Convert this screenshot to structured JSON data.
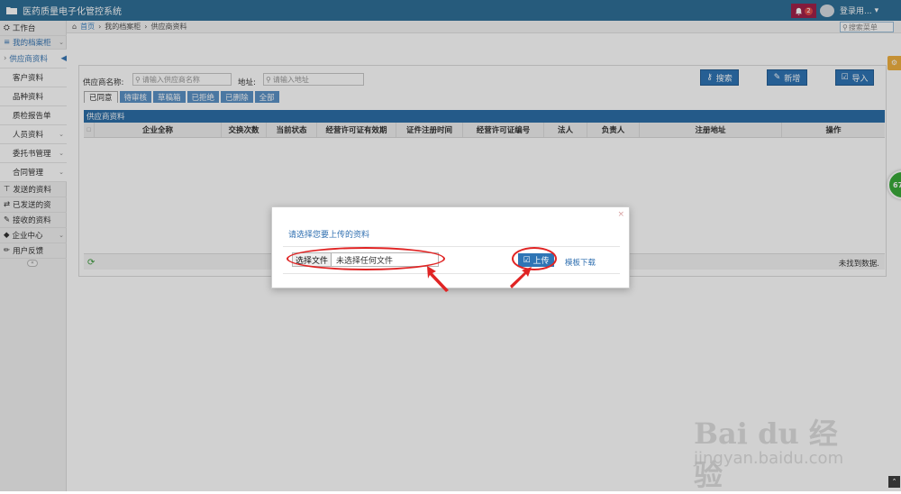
{
  "app": {
    "title": "医药质量电子化管控系统"
  },
  "header": {
    "notification_count": "2",
    "user_name": "登录用..."
  },
  "breadcrumb": {
    "items": [
      "首页",
      "我的档案柜",
      "供应商资料"
    ]
  },
  "menu_search": {
    "placeholder": "搜索菜单"
  },
  "sidebar": {
    "items": [
      {
        "label": "工作台",
        "icon": "dashboard-icon"
      },
      {
        "label": "我的档案柜",
        "icon": "list-icon"
      },
      {
        "label": "供应商资料",
        "active": true
      },
      {
        "label": "客户资料"
      },
      {
        "label": "品种资料"
      },
      {
        "label": "质检报告单"
      },
      {
        "label": "人员资料"
      },
      {
        "label": "委托书管理"
      },
      {
        "label": "合同管理"
      },
      {
        "label": "发送的资料",
        "icon": "send-icon"
      },
      {
        "label": "已发送的资",
        "icon": "exchange-icon"
      },
      {
        "label": "接收的资料",
        "icon": "receive-icon"
      },
      {
        "label": "企业中心",
        "icon": "tag-icon"
      },
      {
        "label": "用户反馈",
        "icon": "pencil-icon"
      }
    ]
  },
  "filters": {
    "supplier_label": "供应商名称:",
    "supplier_placeholder": "请输入供应商名称",
    "address_label": "地址:",
    "address_placeholder": "请输入地址"
  },
  "actions": {
    "search": "搜索",
    "add": "新增",
    "import": "导入"
  },
  "tabs": [
    "已同意",
    "待审核",
    "草稿箱",
    "已拒绝",
    "已删除",
    "全部"
  ],
  "table": {
    "title": "供应商资料",
    "columns": [
      "企业全称",
      "交换次数",
      "当前状态",
      "经营许可证有效期",
      "证件注册时间",
      "经营许可证编号",
      "法人",
      "负责人",
      "注册地址",
      "操作"
    ],
    "empty_text": "未找到数据."
  },
  "modal": {
    "title": "请选择您要上传的资料",
    "close": "×",
    "choose_file": "选择文件",
    "no_file": "未选择任何文件",
    "upload": "上传",
    "template_download": "模板下载"
  },
  "floating": {
    "green_bubble": "67"
  },
  "watermark": {
    "brand": "Bai du 经验",
    "url": "jingyan.baidu.com"
  },
  "colors": {
    "header": "#2f6f98",
    "primary_button": "#2f75b5",
    "highlight": "#e02424"
  }
}
